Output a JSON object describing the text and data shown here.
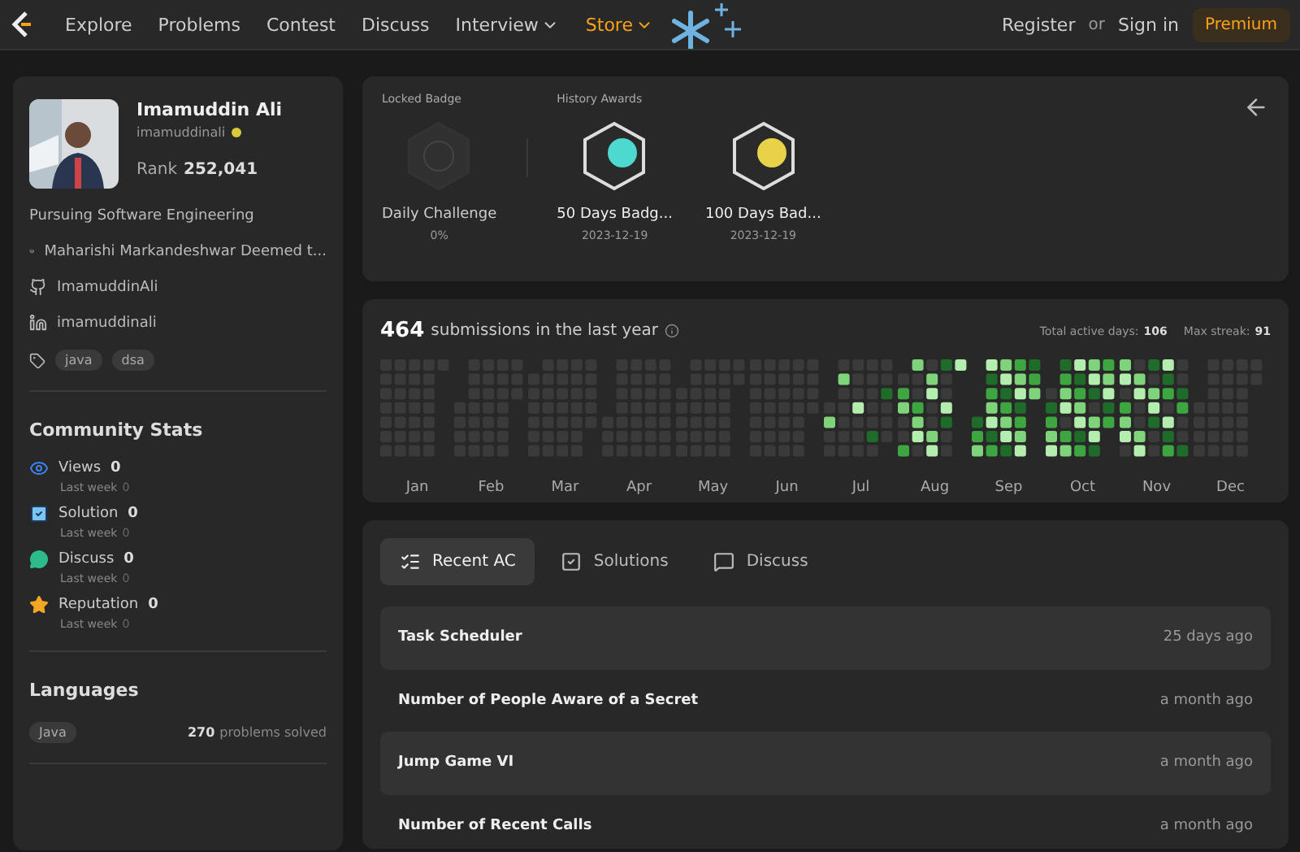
{
  "nav": {
    "items": [
      {
        "label": "Explore",
        "dropdown": false,
        "highlighted": false
      },
      {
        "label": "Problems",
        "dropdown": false,
        "highlighted": false
      },
      {
        "label": "Contest",
        "dropdown": false,
        "highlighted": false
      },
      {
        "label": "Discuss",
        "dropdown": false,
        "highlighted": false
      },
      {
        "label": "Interview",
        "dropdown": true,
        "highlighted": false
      },
      {
        "label": "Store",
        "dropdown": true,
        "highlighted": true
      }
    ],
    "register": "Register",
    "or": "or",
    "sign_in": "Sign in",
    "premium": "Premium"
  },
  "profile": {
    "name": "Imamuddin Ali",
    "username": "imamuddinali",
    "rank_label": "Rank",
    "rank": "252,041",
    "bio": "Pursuing Software Engineering",
    "links": [
      {
        "kind": "school",
        "text": "Maharishi Markandeshwar Deemed t..."
      },
      {
        "kind": "github",
        "text": "ImamuddinAli"
      },
      {
        "kind": "linkedin",
        "text": "imamuddinali"
      }
    ],
    "skills": [
      "java",
      "dsa"
    ]
  },
  "community_stats": {
    "title": "Community Stats",
    "items": [
      {
        "kind": "views",
        "label": "Views",
        "value": "0",
        "sub_label": "Last week",
        "sub_value": "0"
      },
      {
        "kind": "solution",
        "label": "Solution",
        "value": "0",
        "sub_label": "Last week",
        "sub_value": "0"
      },
      {
        "kind": "discuss",
        "label": "Discuss",
        "value": "0",
        "sub_label": "Last week",
        "sub_value": "0"
      },
      {
        "kind": "reputation",
        "label": "Reputation",
        "value": "0",
        "sub_label": "Last week",
        "sub_value": "0"
      }
    ]
  },
  "languages": {
    "title": "Languages",
    "items": [
      {
        "name": "Java",
        "count": "270",
        "suffix": "problems solved"
      }
    ]
  },
  "badges": {
    "locked_title": "Locked Badge",
    "history_title": "History Awards",
    "locked": {
      "name": "Daily Challenge",
      "caption": "0%"
    },
    "awards": [
      {
        "kind": "fifty",
        "name": "50 Days Badg...",
        "date": "2023-12-19"
      },
      {
        "kind": "hundred",
        "name": "100 Days Bad...",
        "date": "2023-12-19"
      }
    ]
  },
  "submissions": {
    "count": "464",
    "text": "submissions in the last year",
    "active_label": "Total active days:",
    "active_value": "106",
    "streak_label": "Max streak:",
    "streak_value": "91",
    "months": [
      "Jan",
      "Feb",
      "Mar",
      "Apr",
      "May",
      "Jun",
      "Jul",
      "Aug",
      "Sep",
      "Oct",
      "Nov",
      "Dec"
    ]
  },
  "recent": {
    "tabs": [
      {
        "kind": "ac",
        "label": "Recent AC",
        "selected": true
      },
      {
        "kind": "solutions",
        "label": "Solutions",
        "selected": false
      },
      {
        "kind": "discuss",
        "label": "Discuss",
        "selected": false
      }
    ],
    "rows": [
      {
        "title": "Task Scheduler",
        "time": "25 days ago"
      },
      {
        "title": "Number of People Aware of a Secret",
        "time": "a month ago"
      },
      {
        "title": "Jump Game VI",
        "time": "a month ago"
      },
      {
        "title": "Number of Recent Calls",
        "time": "a month ago"
      }
    ]
  }
}
